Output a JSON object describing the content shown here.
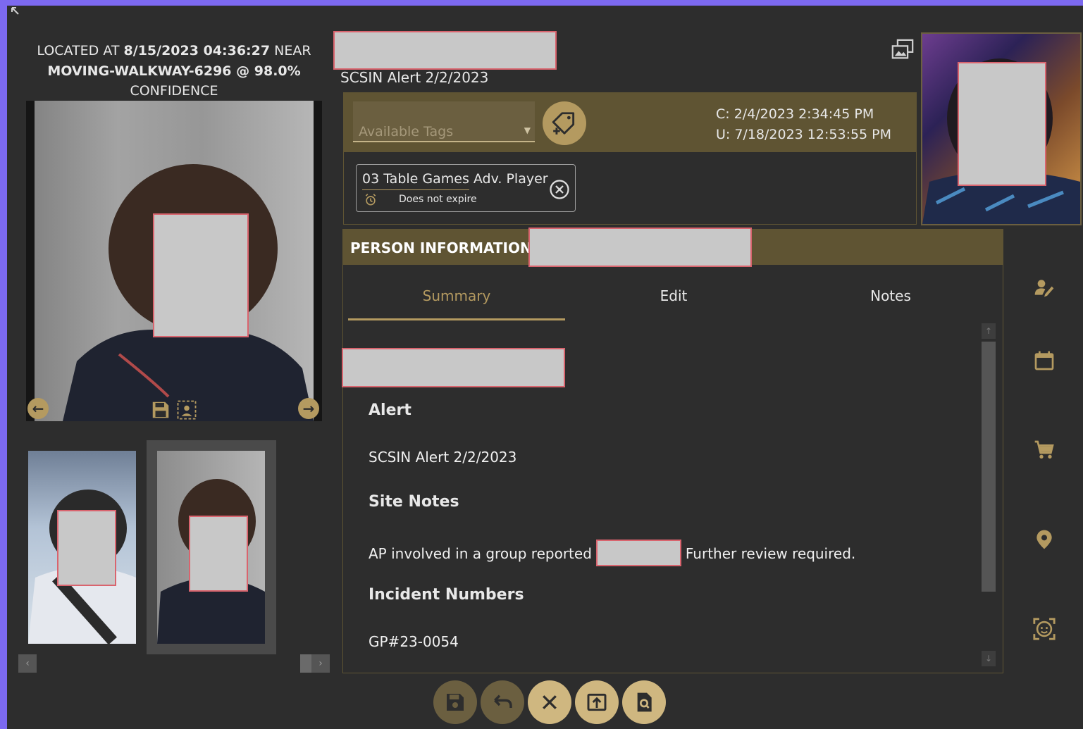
{
  "located": {
    "prefix": "LOCATED AT ",
    "timestamp": "8/15/2023 04:36:27",
    "near_label": " NEAR ",
    "location": "MOVING-WALKWAY-6296 @ 98.0%",
    "confidence_label": "CONFIDENCE"
  },
  "record": {
    "subtitle": "SCSIN Alert 2/2/2023"
  },
  "tags": {
    "placeholder": "Available Tags",
    "created": "C: 2/4/2023 2:34:45 PM",
    "updated": "U: 7/18/2023 12:53:55 PM",
    "chip_label": "03 Table Games Adv. Player",
    "chip_expiry": "Does not expire"
  },
  "person": {
    "header": "PERSON INFORMATION",
    "tabs": [
      {
        "label": "Summary"
      },
      {
        "label": "Edit"
      },
      {
        "label": "Notes"
      }
    ],
    "alert_heading": "Alert",
    "alert_value": "SCSIN Alert 2/2/2023",
    "site_notes_heading": "Site Notes",
    "site_notes_before": "AP involved in a group reported",
    "site_notes_after": "Further review required.",
    "incident_heading": "Incident Numbers",
    "incident_value": "GP#23-0054"
  },
  "colors": {
    "accent": "#b49a60",
    "panel_header": "#5f5433",
    "background": "#2d2d2d",
    "frame": "#7c69f0"
  },
  "icons": {
    "side": [
      "edit-person-icon",
      "calendar-icon",
      "cart-icon",
      "location-pin-icon",
      "face-scan-icon"
    ],
    "bottom": [
      "save-icon",
      "undo-icon",
      "close-icon",
      "export-icon",
      "search-document-icon"
    ]
  }
}
